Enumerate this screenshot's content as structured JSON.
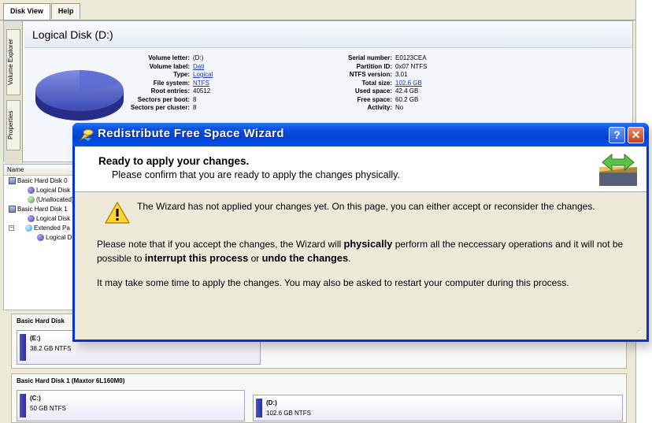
{
  "tabs": [
    "Disk View",
    "Help"
  ],
  "side_tabs": [
    "Volume Explorer",
    "Properties"
  ],
  "volume_panel": {
    "title": "Logical Disk (D:)",
    "info_left": [
      {
        "key": "Volume letter:",
        "value": "(D:)",
        "link": false
      },
      {
        "key": "Volume label:",
        "value": "Dati",
        "link": true
      },
      {
        "key": "Type:",
        "value": "Logical",
        "link": true
      },
      {
        "key": "File system:",
        "value": "NTFS",
        "link": true
      },
      {
        "key": "Root entries:",
        "value": "40512",
        "link": false
      },
      {
        "key": "Sectors per boot:",
        "value": "8",
        "link": false
      },
      {
        "key": "Sectors per cluster:",
        "value": "8",
        "link": false
      }
    ],
    "info_right": [
      {
        "key": "Serial number:",
        "value": "E0123CEA",
        "link": false
      },
      {
        "key": "Partition ID:",
        "value": "0x07 NTFS",
        "link": false
      },
      {
        "key": "NTFS version:",
        "value": "3.01",
        "link": false
      },
      {
        "key": "Total size:",
        "value": "102.6 GB",
        "link": true
      },
      {
        "key": "Used space:",
        "value": "42.4 GB",
        "link": false
      },
      {
        "key": "Free space:",
        "value": "60.2 GB",
        "link": false
      },
      {
        "key": "Activity:",
        "value": "No",
        "link": false
      }
    ]
  },
  "tree": {
    "header": "Name",
    "items": [
      "Basic Hard Disk 0",
      "Logical Disk",
      "(Unallocated)",
      "Basic Hard Disk 1",
      "Logical Disk",
      "Extended Pa",
      "Logical D"
    ]
  },
  "disk_map": {
    "disk0_title": "Basic Hard Disk",
    "disk0_part": {
      "letter": "(E:)",
      "size": "38.2 GB NTFS"
    },
    "disk1_title": "Basic Hard Disk 1 (Maxtor 6L160M0)",
    "disk1_parts": [
      {
        "letter": "(C:)",
        "size": "50 GB NTFS"
      },
      {
        "letter": "(D:)",
        "size": "102.6 GB NTFS"
      }
    ]
  },
  "wizard": {
    "title": "Redistribute Free Space Wizard",
    "help_label": "?",
    "close_label": "✕",
    "heading": "Ready to apply your changes.",
    "subheading": "Please confirm that you are ready to apply the changes physically.",
    "warning": "The Wizard has not applied your changes yet. On this page, you can either accept or reconsider the changes.",
    "note": {
      "part1": "Please note that if you accept the changes, the Wizard will ",
      "bold1": "physically",
      "part2": " perform all the neccessary operations and it will not be possible to ",
      "bold2": "interrupt this process",
      "part3": " or ",
      "bold3": "undo the changes",
      "part4": "."
    },
    "time_text": "It may take some time to apply the changes. You may also be asked to restart your computer during this process."
  }
}
